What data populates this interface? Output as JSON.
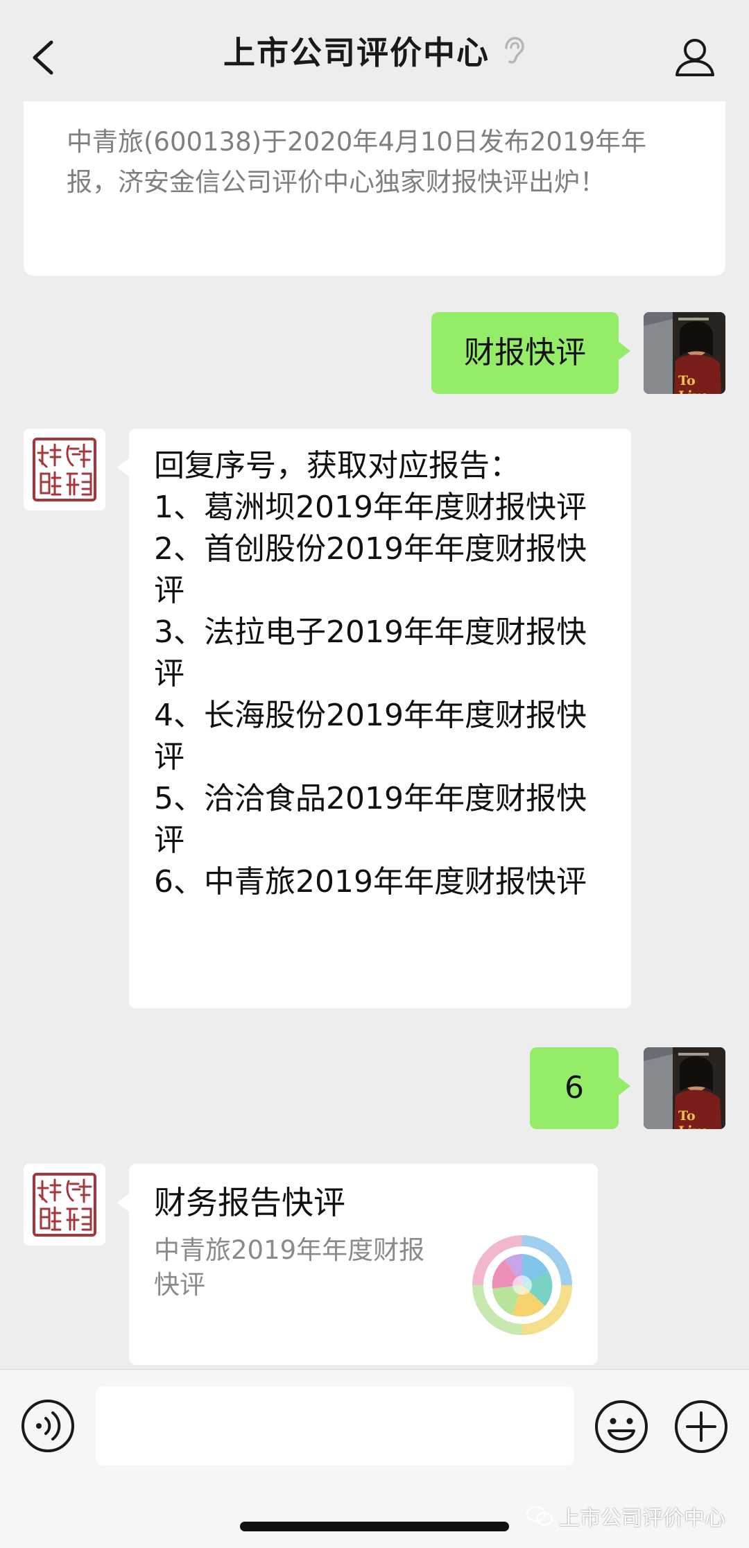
{
  "header": {
    "title": "上市公司评价中心"
  },
  "chat": {
    "top_card_text": "中青旅(600138)于2020年4月10日发布2019年年报，济安金信公司评价中心独家财报快评出炉！",
    "msg_user_1": "财报快评",
    "menu": {
      "intro": "回复序号，获取对应报告：",
      "items": [
        "1、葛洲坝2019年年度财报快评",
        "2、首创股份2019年年度财报快评",
        "3、法拉电子2019年年度财报快评",
        "4、长海股份2019年年度财报快评",
        "5、洽洽食品2019年年度财报快评",
        "6、中青旅2019年年度财报快评"
      ]
    },
    "msg_user_2": "6",
    "link_card": {
      "title": "财务报告快评",
      "description": "中青旅2019年年度财报快评"
    },
    "user_avatar_caption": "To Live"
  },
  "input": {
    "placeholder": ""
  },
  "watermark": "上市公司评价中心",
  "colors": {
    "background": "#ededed",
    "green_bubble": "#95ec69",
    "white_bubble": "#ffffff"
  },
  "icons": {
    "back": "chevron-left-icon",
    "ear": "ear-icon",
    "profile": "person-icon",
    "voice": "voice-icon",
    "emoji": "emoji-icon",
    "plus": "plus-icon"
  }
}
